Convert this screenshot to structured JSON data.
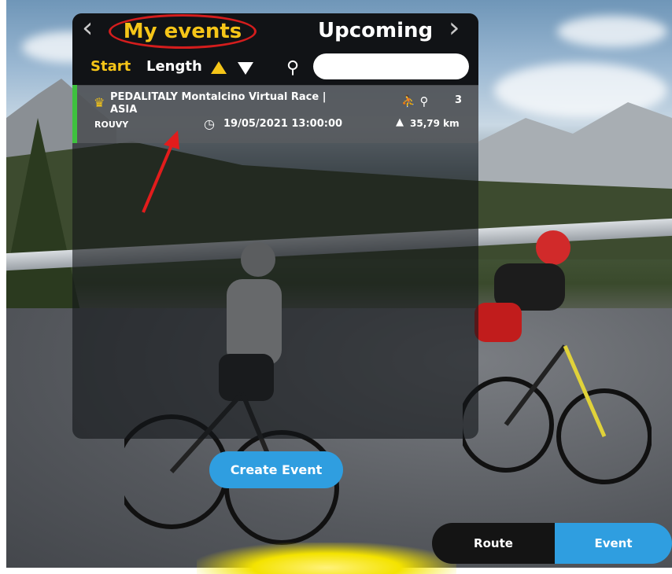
{
  "tabs": {
    "my_events": "My events",
    "upcoming": "Upcoming",
    "prev_arrow": "‹",
    "next_arrow": "›"
  },
  "sort": {
    "start_label": "Start",
    "length_label": "Length"
  },
  "search": {
    "value": "",
    "icon": "search-icon"
  },
  "events": [
    {
      "title": "PEDALITALY Montalcino Virtual Race | ASIA",
      "organizer": "ROUVY",
      "datetime": "19/05/2021 13:00:00",
      "riders": "3",
      "distance": "35,79  km",
      "status_color": "#3ec13e",
      "icons": [
        "crown-icon",
        "clock-icon",
        "race-icon",
        "cyclist-icon",
        "elevation-icon"
      ]
    }
  ],
  "buttons": {
    "create_event": "Create Event"
  },
  "mode_toggle": {
    "route": "Route",
    "event": "Event",
    "selected": "Event"
  },
  "colors": {
    "accent_yellow": "#f5c518",
    "accent_blue": "#2f9ee0",
    "highlight_red": "#d41d1d",
    "event_green": "#3ec13e"
  }
}
